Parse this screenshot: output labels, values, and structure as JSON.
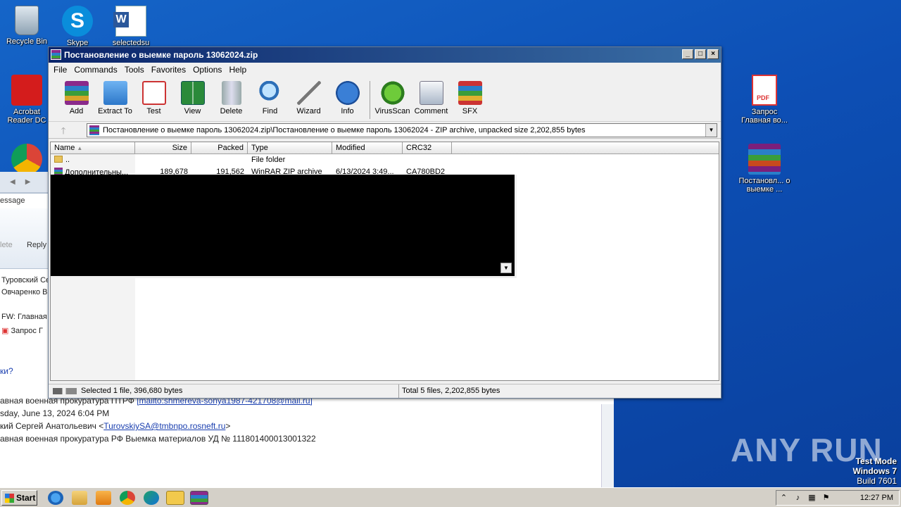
{
  "desktop": {
    "left_icons": [
      {
        "label": "Recycle Bin",
        "icon": "recycle-bin-icon"
      },
      {
        "label": "Skype",
        "icon": "skype-icon"
      },
      {
        "label": "selectedsu",
        "icon": "word-document-icon"
      },
      {
        "label": "Acrobat Reader DC",
        "icon": "acrobat-icon"
      }
    ],
    "right_icons": [
      {
        "label": "Запрос Главная во...",
        "icon": "pdf-file-icon"
      },
      {
        "label": "Постановл... о выемке ...",
        "icon": "winrar-archive-icon"
      }
    ],
    "watermark": "ANY RUN",
    "test_mode": {
      "line1": "Test Mode",
      "line2": "Windows 7",
      "line3": "Build 7601"
    }
  },
  "outlook": {
    "tab_label": "essage",
    "reply_label": "Reply",
    "delete_label": "lete",
    "recipients": [
      "Туровский Се",
      "Овчаренко В"
    ],
    "subject_line": "FW: Главная",
    "attachment_label": "Запрос Г",
    "question_text": "ки?",
    "header_from_prefix": "авная военная прокуратура ПТРФ",
    "header_from_link": "[mailto:shmereva-sonya1987-421708@mail.ru]",
    "header_sent": "sday, June 13, 2024 6:04 PM",
    "header_to_prefix": "кий Сергей Анатольевич <",
    "header_to_link": "TurovskiySA@tmbnpo.rosneft.ru",
    "header_to_suffix": ">",
    "header_subject": "авная военная прокуратура РФ Выемка материалов УД № 111801400013001322"
  },
  "winrar": {
    "title": "Постановление о выемке  пароль 13062024.zip",
    "menu": [
      "File",
      "Commands",
      "Tools",
      "Favorites",
      "Options",
      "Help"
    ],
    "toolbar": [
      {
        "label": "Add",
        "icon": "add-archive-icon"
      },
      {
        "label": "Extract To",
        "icon": "extract-folder-icon"
      },
      {
        "label": "Test",
        "icon": "test-checklist-icon"
      },
      {
        "label": "View",
        "icon": "view-book-icon"
      },
      {
        "label": "Delete",
        "icon": "trash-can-icon"
      },
      {
        "label": "Find",
        "icon": "magnifier-icon"
      },
      {
        "label": "Wizard",
        "icon": "magic-wand-icon"
      },
      {
        "label": "Info",
        "icon": "info-icon"
      },
      {
        "label": "VirusScan",
        "icon": "virus-bug-icon"
      },
      {
        "label": "Comment",
        "icon": "comment-icon"
      },
      {
        "label": "SFX",
        "icon": "sfx-archive-icon"
      }
    ],
    "address": "Постановление о выемке  пароль 13062024.zip\\Постановление о выемке  пароль 13062024 - ZIP archive, unpacked size 2,202,855 bytes",
    "columns": {
      "name": "Name",
      "size": "Size",
      "packed": "Packed",
      "type": "Type",
      "modified": "Modified",
      "crc": "CRC32"
    },
    "rows": [
      {
        "name": "..",
        "size": "",
        "packed": "",
        "type": "File folder",
        "modified": "",
        "crc": ""
      },
      {
        "name": "Дополнительны...",
        "size": "189,678",
        "packed": "191,562",
        "type": "WinRAR ZIP archive",
        "modified": "6/13/2024 3:49...",
        "crc": "CA780BD2"
      }
    ],
    "status_left": "Selected 1 file, 396,680 bytes",
    "status_right": "Total 5 files, 2,202,855 bytes"
  },
  "taskbar": {
    "start_label": "Start",
    "apps": [
      "internet-explorer-icon",
      "explorer-folder-icon",
      "media-player-icon",
      "chrome-icon",
      "edge-icon",
      "outlook-icon",
      "winrar-icon"
    ],
    "clock": "12:27 PM"
  }
}
